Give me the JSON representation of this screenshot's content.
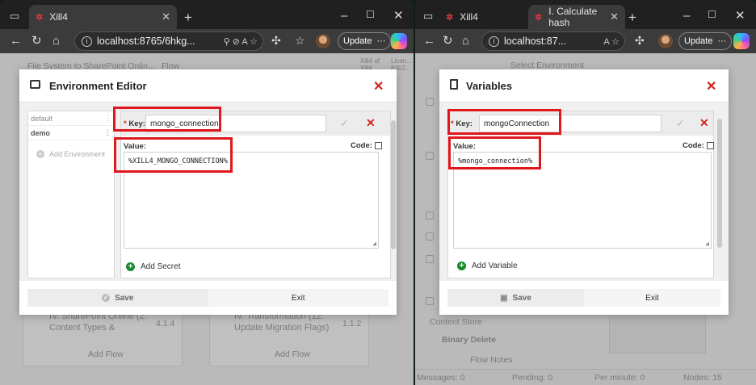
{
  "left": {
    "tabs": [
      {
        "label": "Xill4"
      }
    ],
    "url": "localhost:8765/6hkg...",
    "update_label": "Update",
    "background": {
      "bread": "File System to SharePoint Onlin...",
      "flow_label": "Flow",
      "xill": "Xill4 of Xill4",
      "lic": "Licen... 8/8/2...",
      "card1_title": "IV. SharePoint Online (2. Content Types &",
      "card1_ver": "4.1.4",
      "card2_title": "IV. Transformation (12. Update Migration Flags)",
      "card2_ver": "1.1.2",
      "add_flow": "Add Flow"
    },
    "modal": {
      "title": "Environment Editor",
      "envs": [
        "default",
        "demo"
      ],
      "add_env": "Add Environment",
      "key_label": "Key:",
      "key_value": "mongo_connection",
      "value_label": "Value:",
      "code_label": "Code:",
      "value_text": "%XILL4_MONGO_CONNECTION%",
      "add_label": "Add Secret",
      "save_label": "Save",
      "exit_label": "Exit"
    }
  },
  "right": {
    "tabs": [
      {
        "label": "Xill4"
      },
      {
        "label": "I. Calculate hash"
      }
    ],
    "url": "localhost:87...",
    "update_label": "Update",
    "background": {
      "select_env": "Select Environment",
      "content_store": "Content Store",
      "binary_delete": "Binary Delete",
      "flow_notes": "Flow Notes",
      "status_messages": "Messages: 0",
      "status_pending": "Pending: 0",
      "status_perminute": "Per minute: 0",
      "status_nodes": "Nodes: 15"
    },
    "modal": {
      "title": "Variables",
      "key_label": "Key:",
      "key_value": "mongoConnection",
      "value_label": "Value:",
      "code_label": "Code:",
      "value_text": "%mongo_connection%",
      "add_label": "Add Variable",
      "save_label": "Save",
      "exit_label": "Exit"
    }
  },
  "colors": {
    "highlight": "#e0171c",
    "accent_red": "#d6221c",
    "add_green": "#1b8a2e"
  }
}
